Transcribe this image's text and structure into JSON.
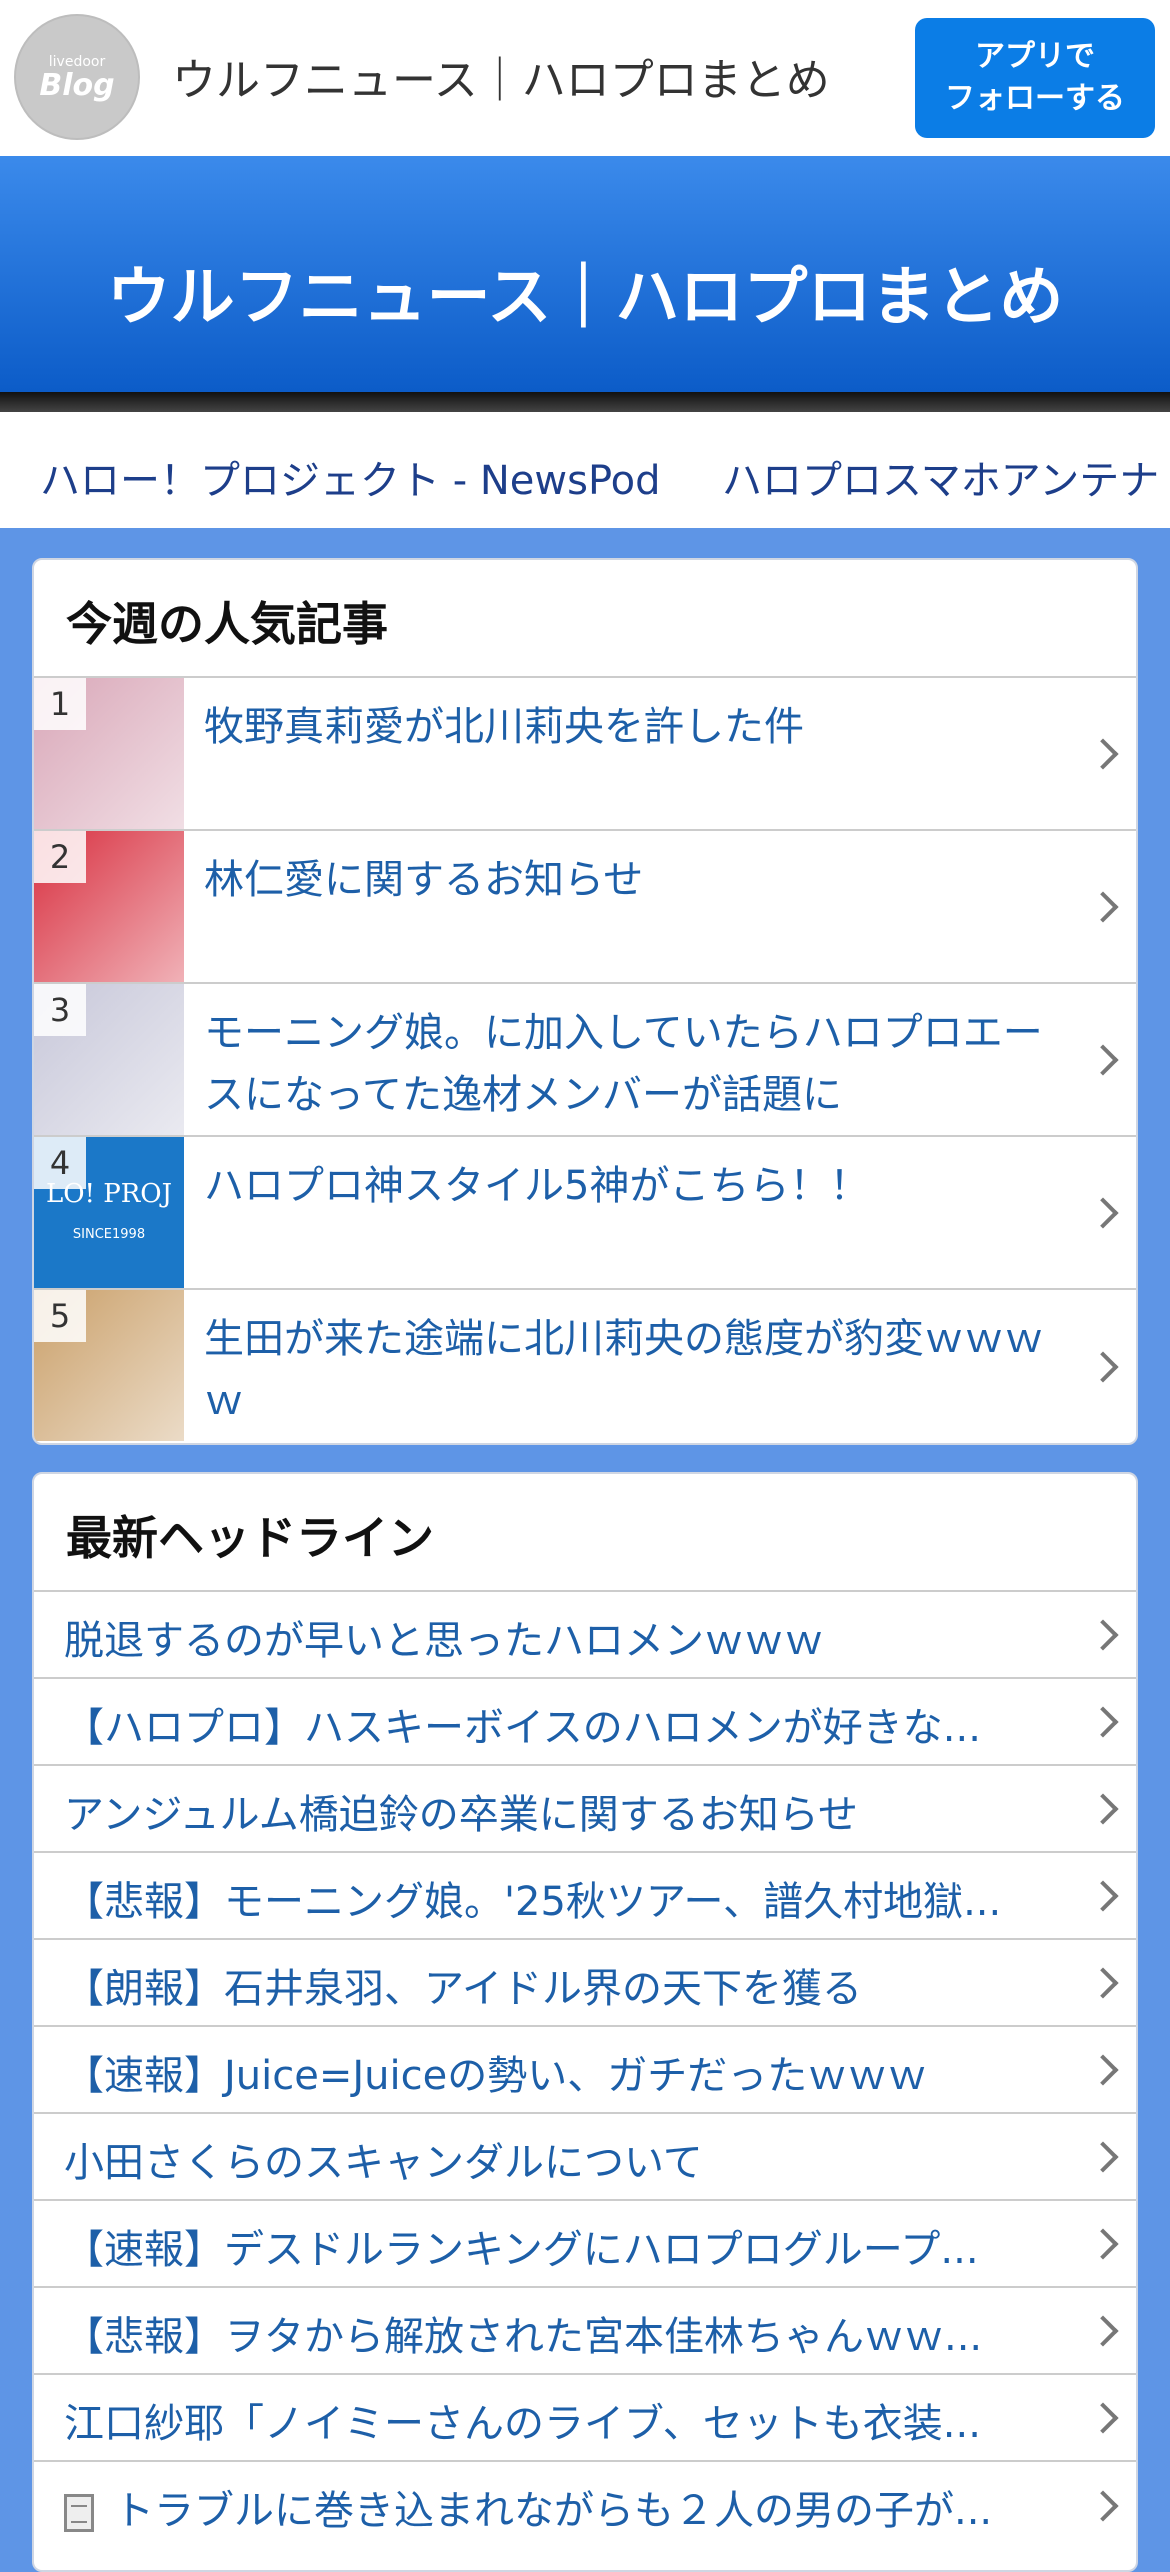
{
  "header": {
    "logo_small": "livedoor",
    "logo_big": "Blog",
    "site_title": "ウルフニュース｜ハロプロまとめ",
    "follow_line1": "アプリで",
    "follow_line2": "フォローする"
  },
  "hero": {
    "title": "ウルフニュース｜ハロプロまとめ"
  },
  "antenna_links": [
    "ハロー！プロジェクト - NewsPod",
    "ハロプロスマホアンテナ"
  ],
  "popular": {
    "title": "今週の人気記事",
    "items": [
      {
        "rank": "1",
        "title": "牧野真莉愛が北川莉央を許した件",
        "thumb_color": "#d9a7b8"
      },
      {
        "rank": "2",
        "title": "林仁愛に関するお知らせ",
        "thumb_color": "#d83040"
      },
      {
        "rank": "3",
        "title": "モーニング娘。に加入していたらハロプロエースになってた逸材メンバーが話題に",
        "thumb_color": "#c7c7d9"
      },
      {
        "rank": "4",
        "title": "ハロプロ神スタイル5神がこちら！！",
        "thumb_color": "#1b78c8",
        "thumb_text1": "LO! PROJ",
        "thumb_text2": "SINCE1998"
      },
      {
        "rank": "5",
        "title": "生田が来た途端に北川莉央の態度が豹変ｗｗｗｗ",
        "thumb_color": "#caa06a"
      }
    ]
  },
  "latest": {
    "title": "最新ヘッドライン",
    "items": [
      "脱退するのが早いと思ったハロメンｗｗｗ",
      "【ハロプロ】ハスキーボイスのハロメンが好きな...",
      "アンジュルム橋迫鈴の卒業に関するお知らせ",
      "【悲報】モーニング娘。'25秋ツアー、譜久村地獄...",
      "【朗報】石井泉羽、アイドル界の天下を獲る",
      "【速報】Juice=Juiceの勢い、ガチだったｗｗｗ",
      "小田さくらのスキャンダルについて",
      "【速報】デスドルランキングにハロプログループ...",
      "【悲報】ヲタから解放された宮本佳林ちゃんｗｗ...",
      "江口紗耶「ノイミーさんのライブ、セットも衣装...",
      "トラブルに巻き込まれながらも２人の男の子が..."
    ]
  }
}
